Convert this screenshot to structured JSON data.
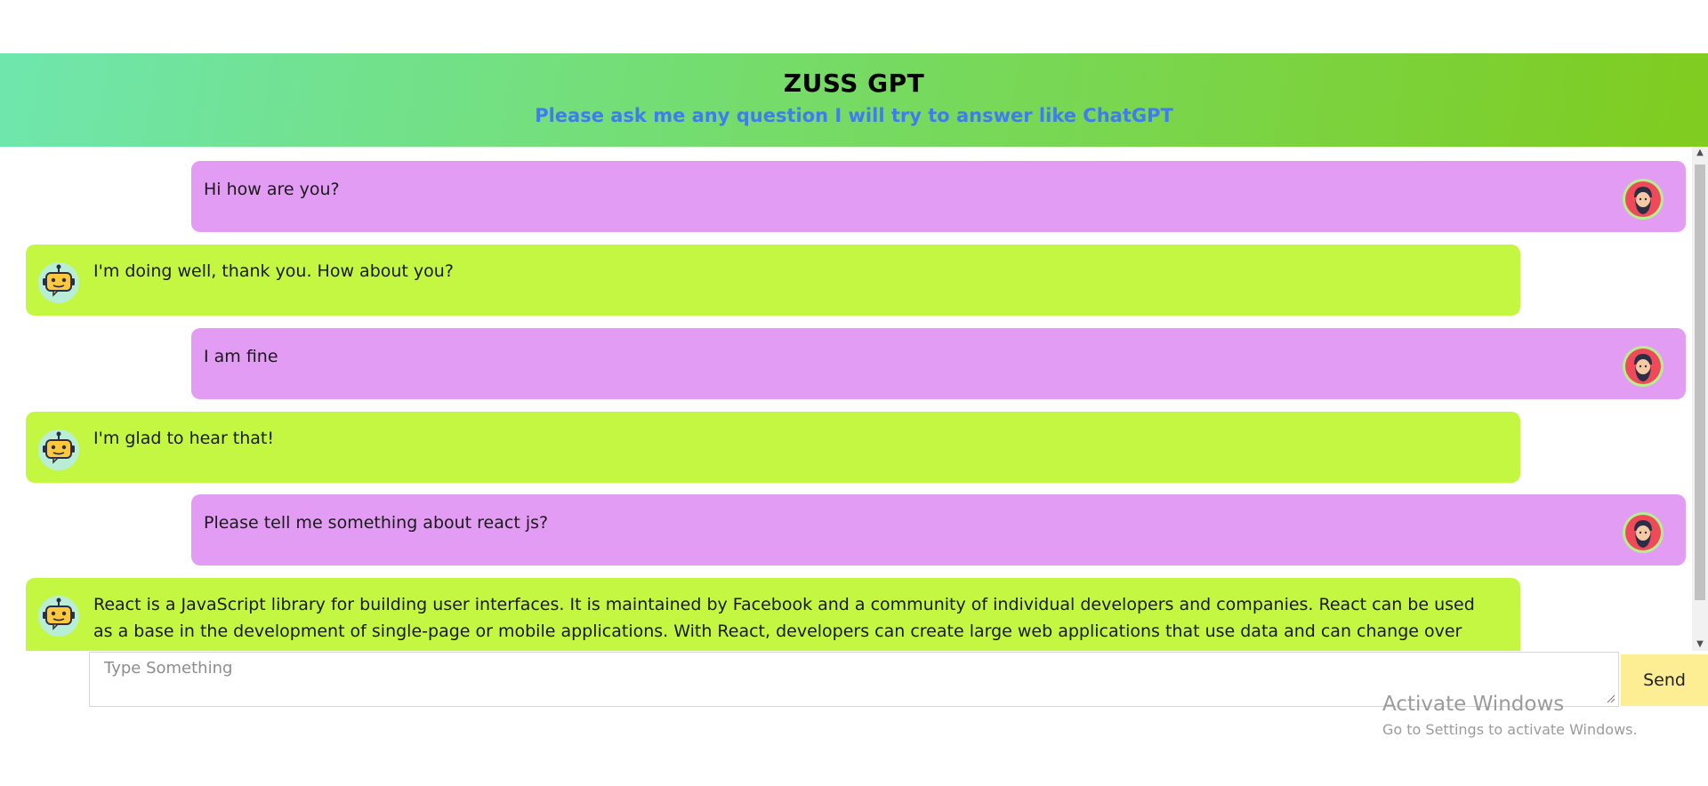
{
  "header": {
    "title": "ZUSS GPT",
    "subtitle": "Please ask me any question I will try to answer like ChatGPT"
  },
  "messages": [
    {
      "role": "user",
      "text": "Hi how are you?",
      "avatar": "bearded-man-avatar"
    },
    {
      "role": "bot",
      "text": "I'm doing well, thank you. How about you?",
      "avatar": "robot-avatar"
    },
    {
      "role": "user",
      "text": "I am fine",
      "avatar": "bearded-man-avatar"
    },
    {
      "role": "bot",
      "text": "I'm glad to hear that!",
      "avatar": "robot-avatar"
    },
    {
      "role": "user",
      "text": "Please tell me something about react js?",
      "avatar": "bearded-man-avatar"
    },
    {
      "role": "bot",
      "text": "React is a JavaScript library for building user interfaces. It is maintained by Facebook and a community of individual developers and companies. React can be used as a base in the development of single-page or mobile applications. With React, developers can create large web applications that use data and can change over time without reloading the page. It",
      "avatar": "robot-avatar"
    }
  ],
  "composer": {
    "placeholder": "Type Something",
    "send_label": "Send"
  },
  "watermark": {
    "title": "Activate Windows",
    "subtitle": "Go to Settings to activate Windows."
  },
  "colors": {
    "user_bubble": "#e39cf3",
    "bot_bubble": "#c4f742",
    "subtitle_text": "#3f7cf2",
    "send_button": "#fdee94"
  }
}
